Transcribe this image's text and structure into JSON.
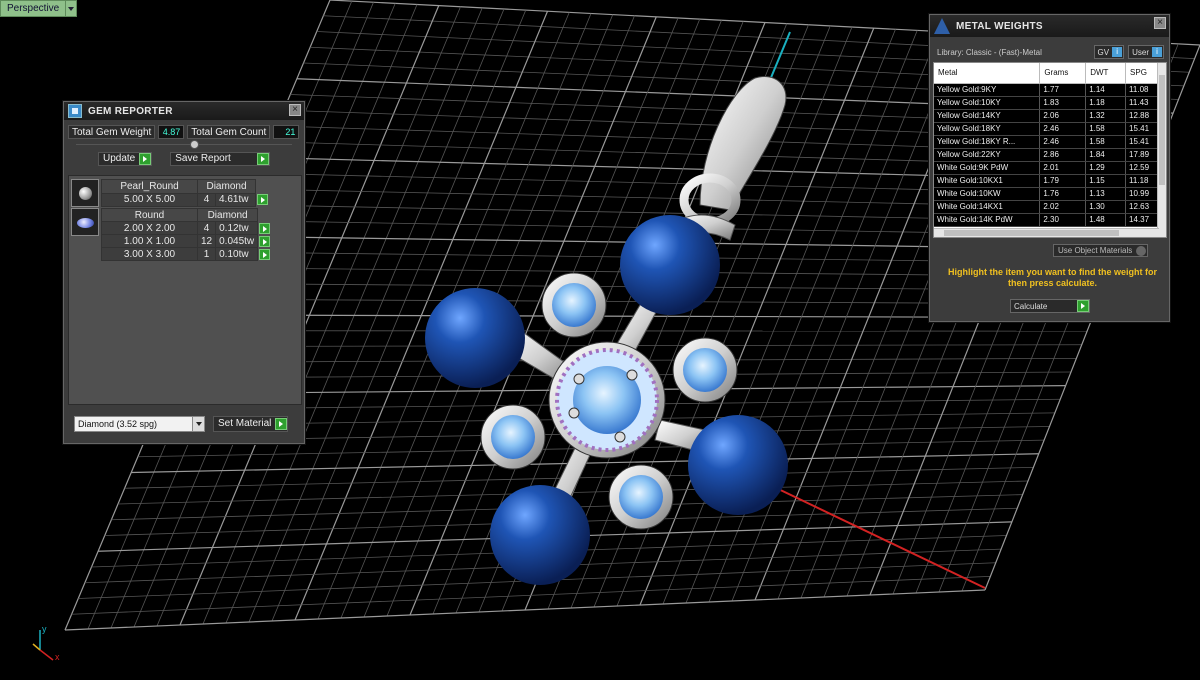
{
  "viewport": {
    "mode_label": "Perspective",
    "axis_y": "y",
    "axis_x": "x"
  },
  "gem_reporter": {
    "title": "GEM REPORTER",
    "total_weight_label": "Total Gem Weight",
    "total_weight_value": "4.87",
    "total_count_label": "Total Gem Count",
    "total_count_value": "21",
    "update_label": "Update",
    "save_report_label": "Save Report",
    "groups": [
      {
        "shape": "Pearl_Round",
        "material": "Diamond",
        "rows": [
          {
            "size": "5.00 X 5.00",
            "count": "4",
            "weight": "4.61tw"
          }
        ]
      },
      {
        "shape": "Round",
        "material": "Diamond",
        "rows": [
          {
            "size": "2.00 X 2.00",
            "count": "4",
            "weight": "0.12tw"
          },
          {
            "size": "1.00 X 1.00",
            "count": "12",
            "weight": "0.045tw"
          },
          {
            "size": "3.00 X 3.00",
            "count": "1",
            "weight": "0.10tw"
          }
        ]
      }
    ],
    "material_select": "Diamond     (3.52 spg)",
    "set_material_label": "Set Material"
  },
  "metal_weights": {
    "title": "METAL WEIGHTS",
    "library": "Library: Classic - (Fast)-Metal",
    "gv_label": "GV",
    "user_label": "User",
    "columns": [
      "Metal",
      "Grams",
      "DWT",
      "SPG"
    ],
    "rows": [
      [
        "Yellow Gold:9KY",
        "1.77",
        "1.14",
        "11.08"
      ],
      [
        "Yellow Gold:10KY",
        "1.83",
        "1.18",
        "11.43"
      ],
      [
        "Yellow Gold:14KY",
        "2.06",
        "1.32",
        "12.88"
      ],
      [
        "Yellow Gold:18KY",
        "2.46",
        "1.58",
        "15.41"
      ],
      [
        "Yellow Gold:18KY R...",
        "2.46",
        "1.58",
        "15.41"
      ],
      [
        "Yellow Gold:22KY",
        "2.86",
        "1.84",
        "17.89"
      ],
      [
        "White Gold:9K PdW",
        "2.01",
        "1.29",
        "12.59"
      ],
      [
        "White Gold:10KX1",
        "1.79",
        "1.15",
        "11.18"
      ],
      [
        "White Gold:10KW",
        "1.76",
        "1.13",
        "10.99"
      ],
      [
        "White Gold:14KX1",
        "2.02",
        "1.30",
        "12.63"
      ],
      [
        "White Gold:14K PdW",
        "2.30",
        "1.48",
        "14.37"
      ]
    ],
    "use_object_materials": "Use Object Materials",
    "hint": "Highlight the item you want to find the weight for then press calculate.",
    "calculate_label": "Calculate"
  },
  "colors": {
    "gem_blue": "#1c4fa8",
    "metal_silver": "#d8d8d8",
    "accent_green": "#2ea02e",
    "hint_yellow": "#f0c020",
    "axis_red": "#d22222",
    "axis_cyan": "#1ab0c0"
  }
}
